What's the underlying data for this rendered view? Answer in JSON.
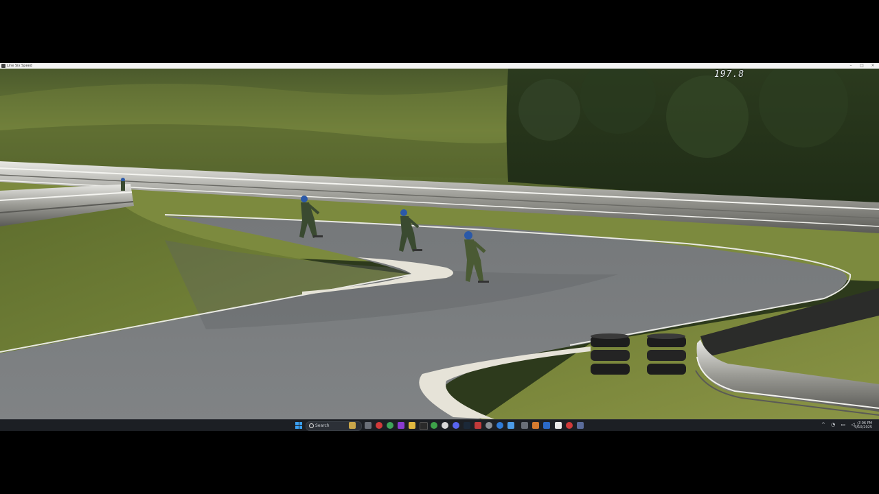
{
  "window": {
    "title": "Line Six Speed"
  },
  "hud": {
    "speed": "197.8"
  },
  "taskbar": {
    "search_placeholder": "Search",
    "clock_time": "7:06 PM",
    "clock_date": "3/10/2025",
    "pinned_icons": [
      "weather-icon",
      "widgets-icon",
      "opera-icon",
      "chrome-icon",
      "vpn-icon",
      "edge-icon",
      "file-explorer-icon",
      "terminal-icon",
      "settings-icon",
      "steam-icon",
      "discord-icon",
      "xbox-icon",
      "media-icon",
      "store-icon",
      "mail-icon",
      "camera-icon",
      "app-icon",
      "notes-icon",
      "security-icon",
      "app-icon-2",
      "calculator-icon",
      "game-icon"
    ]
  },
  "colors": {
    "accent": "#3aa0f3",
    "taskbar_bg": "#1c1f24",
    "track": "#5e6163",
    "grass": "#6d7a36"
  }
}
